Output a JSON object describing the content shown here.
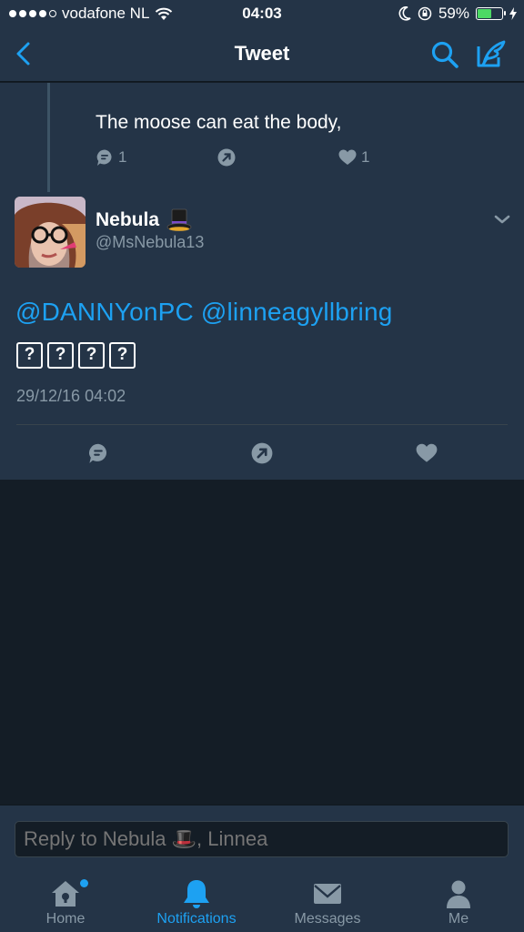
{
  "status_bar": {
    "carrier": "vodafone NL",
    "time": "04:03",
    "battery_percent": "59%",
    "battery_level": 0.59
  },
  "nav": {
    "title": "Tweet"
  },
  "previous_tweet": {
    "text": "The moose can eat the body,",
    "reply_count": "1",
    "like_count": "1"
  },
  "tweet": {
    "name": "Nebula",
    "handle": "@MsNebula13",
    "mention_text": "@DANNYonPC @linneagyllbring",
    "emojis": [
      "?",
      "?",
      "?",
      "?"
    ],
    "timestamp": "29/12/16 04:02"
  },
  "reply": {
    "placeholder": "Reply to Nebula 🎩, Linnea"
  },
  "tabs": [
    {
      "label": "Home"
    },
    {
      "label": "Notifications"
    },
    {
      "label": "Messages"
    },
    {
      "label": "Me"
    }
  ],
  "colors": {
    "accent": "#1da1f2",
    "background": "#141d26",
    "surface": "#243447",
    "muted": "#8899a6"
  }
}
